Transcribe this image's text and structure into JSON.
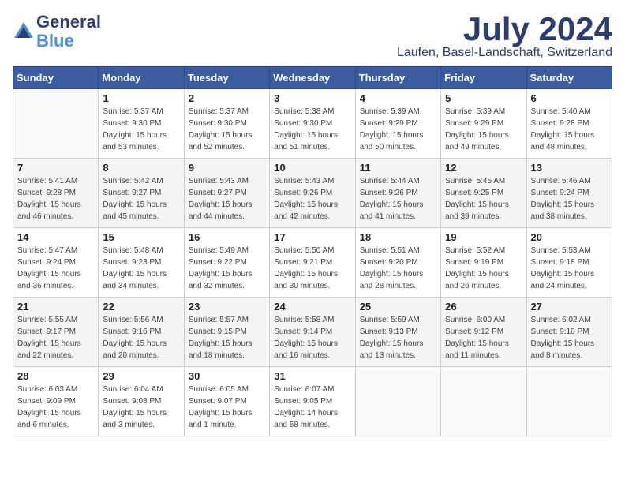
{
  "header": {
    "logo_general": "General",
    "logo_blue": "Blue",
    "month_title": "July 2024",
    "location": "Laufen, Basel-Landschaft, Switzerland"
  },
  "calendar": {
    "days_of_week": [
      "Sunday",
      "Monday",
      "Tuesday",
      "Wednesday",
      "Thursday",
      "Friday",
      "Saturday"
    ],
    "weeks": [
      [
        {
          "day": "",
          "info": ""
        },
        {
          "day": "1",
          "info": "Sunrise: 5:37 AM\nSunset: 9:30 PM\nDaylight: 15 hours\nand 53 minutes."
        },
        {
          "day": "2",
          "info": "Sunrise: 5:37 AM\nSunset: 9:30 PM\nDaylight: 15 hours\nand 52 minutes."
        },
        {
          "day": "3",
          "info": "Sunrise: 5:38 AM\nSunset: 9:30 PM\nDaylight: 15 hours\nand 51 minutes."
        },
        {
          "day": "4",
          "info": "Sunrise: 5:39 AM\nSunset: 9:29 PM\nDaylight: 15 hours\nand 50 minutes."
        },
        {
          "day": "5",
          "info": "Sunrise: 5:39 AM\nSunset: 9:29 PM\nDaylight: 15 hours\nand 49 minutes."
        },
        {
          "day": "6",
          "info": "Sunrise: 5:40 AM\nSunset: 9:28 PM\nDaylight: 15 hours\nand 48 minutes."
        }
      ],
      [
        {
          "day": "7",
          "info": "Sunrise: 5:41 AM\nSunset: 9:28 PM\nDaylight: 15 hours\nand 46 minutes."
        },
        {
          "day": "8",
          "info": "Sunrise: 5:42 AM\nSunset: 9:27 PM\nDaylight: 15 hours\nand 45 minutes."
        },
        {
          "day": "9",
          "info": "Sunrise: 5:43 AM\nSunset: 9:27 PM\nDaylight: 15 hours\nand 44 minutes."
        },
        {
          "day": "10",
          "info": "Sunrise: 5:43 AM\nSunset: 9:26 PM\nDaylight: 15 hours\nand 42 minutes."
        },
        {
          "day": "11",
          "info": "Sunrise: 5:44 AM\nSunset: 9:26 PM\nDaylight: 15 hours\nand 41 minutes."
        },
        {
          "day": "12",
          "info": "Sunrise: 5:45 AM\nSunset: 9:25 PM\nDaylight: 15 hours\nand 39 minutes."
        },
        {
          "day": "13",
          "info": "Sunrise: 5:46 AM\nSunset: 9:24 PM\nDaylight: 15 hours\nand 38 minutes."
        }
      ],
      [
        {
          "day": "14",
          "info": "Sunrise: 5:47 AM\nSunset: 9:24 PM\nDaylight: 15 hours\nand 36 minutes."
        },
        {
          "day": "15",
          "info": "Sunrise: 5:48 AM\nSunset: 9:23 PM\nDaylight: 15 hours\nand 34 minutes."
        },
        {
          "day": "16",
          "info": "Sunrise: 5:49 AM\nSunset: 9:22 PM\nDaylight: 15 hours\nand 32 minutes."
        },
        {
          "day": "17",
          "info": "Sunrise: 5:50 AM\nSunset: 9:21 PM\nDaylight: 15 hours\nand 30 minutes."
        },
        {
          "day": "18",
          "info": "Sunrise: 5:51 AM\nSunset: 9:20 PM\nDaylight: 15 hours\nand 28 minutes."
        },
        {
          "day": "19",
          "info": "Sunrise: 5:52 AM\nSunset: 9:19 PM\nDaylight: 15 hours\nand 26 minutes."
        },
        {
          "day": "20",
          "info": "Sunrise: 5:53 AM\nSunset: 9:18 PM\nDaylight: 15 hours\nand 24 minutes."
        }
      ],
      [
        {
          "day": "21",
          "info": "Sunrise: 5:55 AM\nSunset: 9:17 PM\nDaylight: 15 hours\nand 22 minutes."
        },
        {
          "day": "22",
          "info": "Sunrise: 5:56 AM\nSunset: 9:16 PM\nDaylight: 15 hours\nand 20 minutes."
        },
        {
          "day": "23",
          "info": "Sunrise: 5:57 AM\nSunset: 9:15 PM\nDaylight: 15 hours\nand 18 minutes."
        },
        {
          "day": "24",
          "info": "Sunrise: 5:58 AM\nSunset: 9:14 PM\nDaylight: 15 hours\nand 16 minutes."
        },
        {
          "day": "25",
          "info": "Sunrise: 5:59 AM\nSunset: 9:13 PM\nDaylight: 15 hours\nand 13 minutes."
        },
        {
          "day": "26",
          "info": "Sunrise: 6:00 AM\nSunset: 9:12 PM\nDaylight: 15 hours\nand 11 minutes."
        },
        {
          "day": "27",
          "info": "Sunrise: 6:02 AM\nSunset: 9:10 PM\nDaylight: 15 hours\nand 8 minutes."
        }
      ],
      [
        {
          "day": "28",
          "info": "Sunrise: 6:03 AM\nSunset: 9:09 PM\nDaylight: 15 hours\nand 6 minutes."
        },
        {
          "day": "29",
          "info": "Sunrise: 6:04 AM\nSunset: 9:08 PM\nDaylight: 15 hours\nand 3 minutes."
        },
        {
          "day": "30",
          "info": "Sunrise: 6:05 AM\nSunset: 9:07 PM\nDaylight: 15 hours\nand 1 minute."
        },
        {
          "day": "31",
          "info": "Sunrise: 6:07 AM\nSunset: 9:05 PM\nDaylight: 14 hours\nand 58 minutes."
        },
        {
          "day": "",
          "info": ""
        },
        {
          "day": "",
          "info": ""
        },
        {
          "day": "",
          "info": ""
        }
      ]
    ]
  }
}
